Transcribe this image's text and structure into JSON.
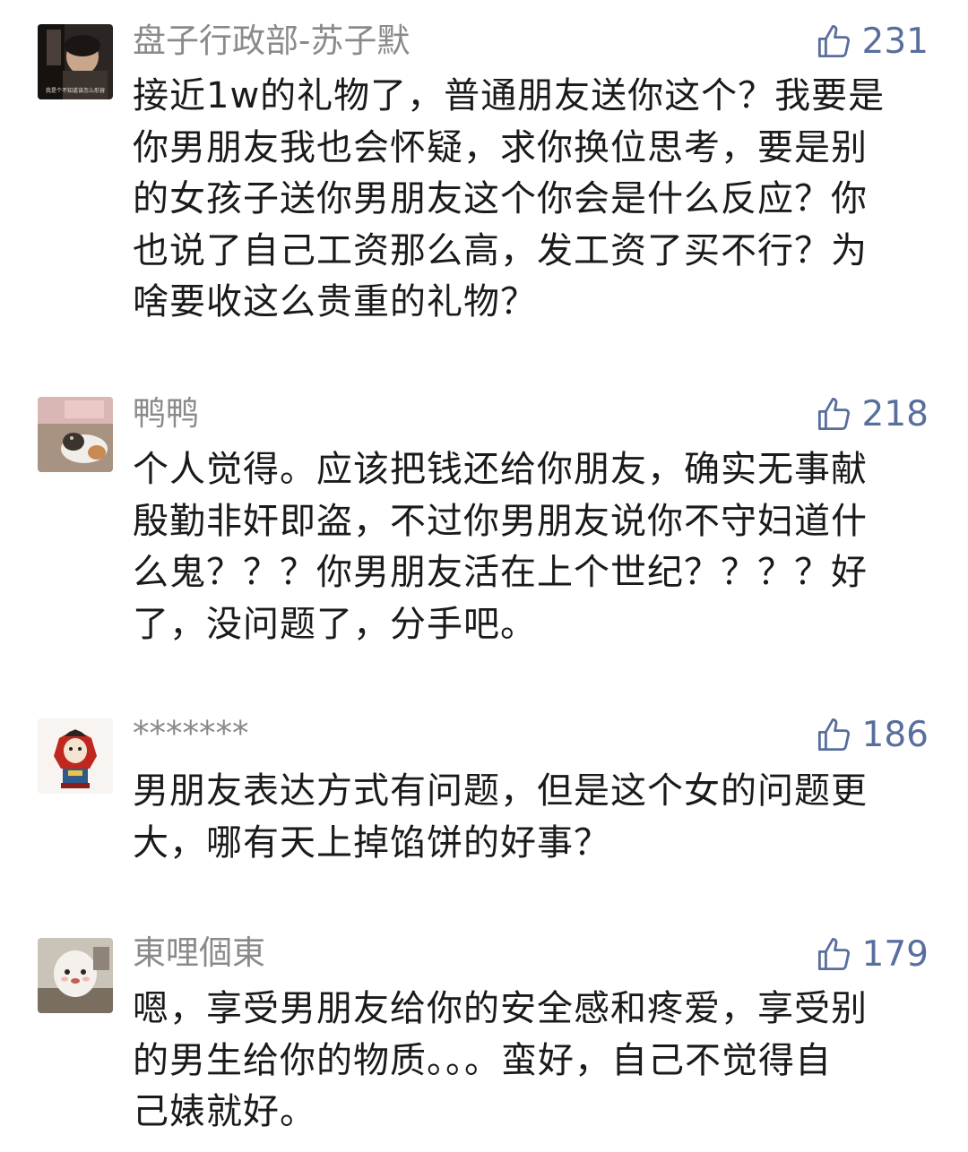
{
  "colors": {
    "username": "#8a8a8a",
    "like": "#586e9c",
    "text": "#1a1a1a",
    "background": "#ffffff"
  },
  "comments": [
    {
      "username": "盘子行政部-苏子默",
      "likes": "231",
      "avatar_caption": "我是个不知道该怎么形容",
      "lines": [
        "接近1w的礼物了，普通朋友送你这个？我要是",
        "你男朋友我也会怀疑，求你换位思考，要是别",
        "的女孩子送你男朋友这个你会是什么反应？你",
        "也说了自己工资那么高，发工资了买不行？为",
        "啥要收这么贵重的礼物？"
      ]
    },
    {
      "username": "鸭鸭",
      "likes": "218",
      "lines": [
        "个人觉得。应该把钱还给你朋友，确实无事献",
        "殷勤非奸即盗，不过你男朋友说你不守妇道什",
        "么鬼？？？你男朋友活在上个世纪？？？？好",
        "了，没问题了，分手吧。"
      ]
    },
    {
      "username": "*******",
      "likes": "186",
      "lines": [
        "男朋友表达方式有问题，但是这个女的问题更",
        "大，哪有天上掉馅饼的好事？"
      ]
    },
    {
      "username": "東哩個東",
      "likes": "179",
      "lines": [
        "嗯，享受男朋友给你的安全感和疼爱，享受别",
        "的男生给你的物质。。。蛮好，自己不觉得自",
        "己婊就好。"
      ]
    }
  ]
}
